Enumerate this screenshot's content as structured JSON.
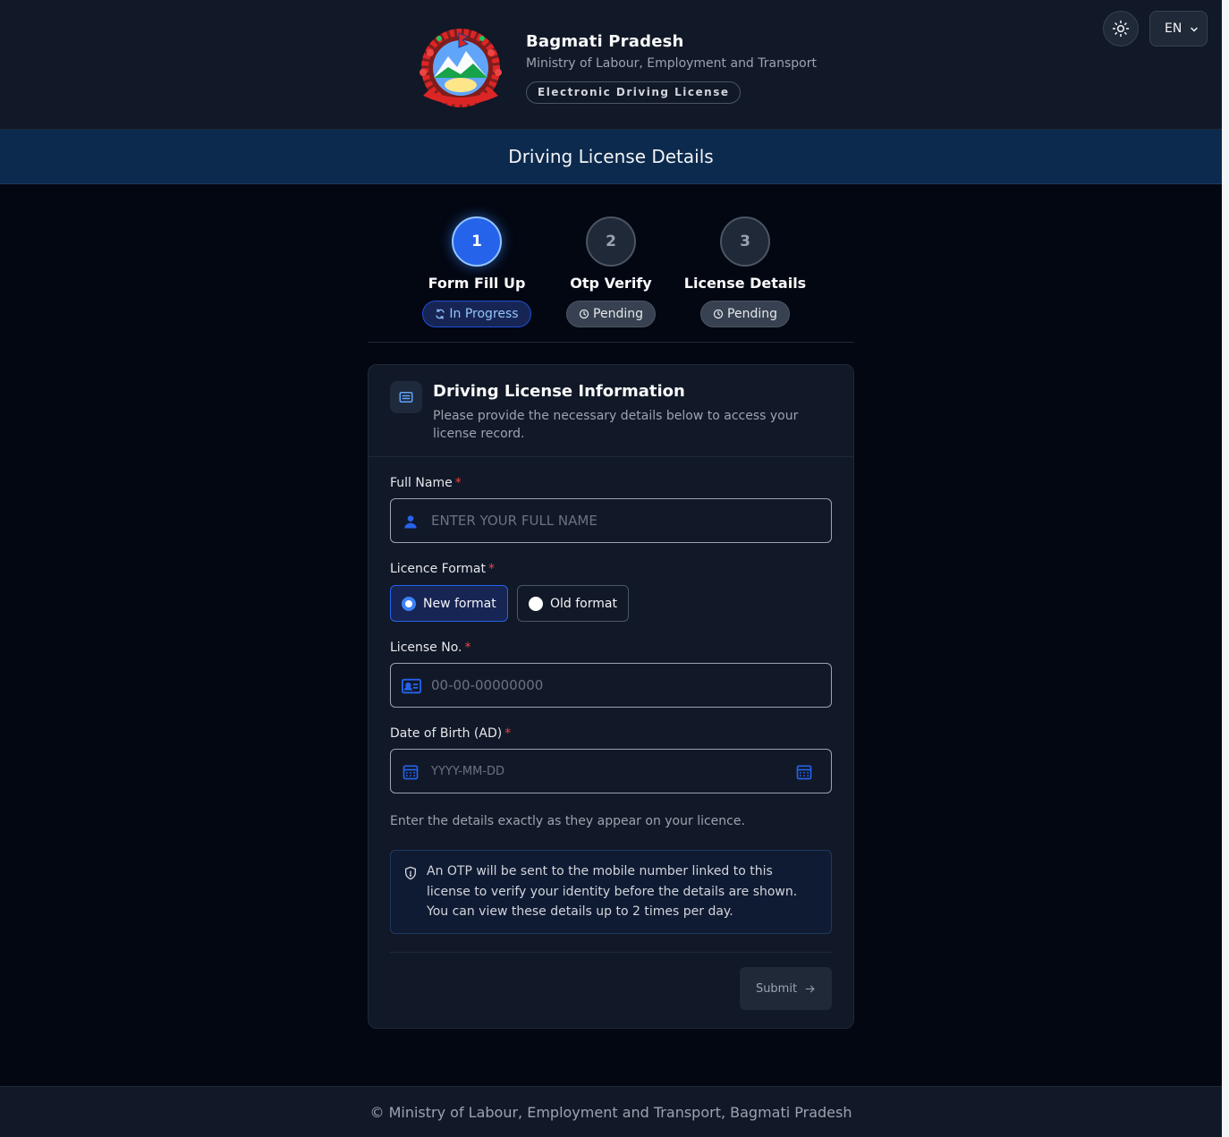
{
  "header": {
    "title": "Bagmati Pradesh",
    "subtitle": "Ministry of Labour, Employment and Transport",
    "badge": "Electronic Driving License",
    "language": "EN",
    "theme_icon": "sun-icon",
    "emblem_icon": "nepal-emblem-icon"
  },
  "banner": {
    "title": "Driving License Details"
  },
  "steps": [
    {
      "number": "1",
      "label": "Form Fill Up",
      "status": "In Progress",
      "status_icon": "refresh-icon"
    },
    {
      "number": "2",
      "label": "Otp Verify",
      "status": "Pending",
      "status_icon": "clock-icon"
    },
    {
      "number": "3",
      "label": "License Details",
      "status": "Pending",
      "status_icon": "clock-icon"
    }
  ],
  "card": {
    "title": "Driving License Information",
    "description": "Please provide the necessary details below to access your license record.",
    "icon": "document-icon"
  },
  "form": {
    "full_name": {
      "label": "Full Name",
      "required": "*",
      "placeholder": "ENTER YOUR FULL NAME",
      "icon": "user-icon"
    },
    "licence_format": {
      "label": "Licence Format",
      "required": "*",
      "options": [
        {
          "label": "New format",
          "selected": true
        },
        {
          "label": "Old format",
          "selected": false
        }
      ]
    },
    "license_no": {
      "label": "License No.",
      "required": "*",
      "placeholder": "00-00-00000000",
      "icon": "id-card-icon"
    },
    "dob": {
      "label": "Date of Birth (AD)",
      "required": "*",
      "placeholder": "YYYY-MM-DD",
      "icon": "calendar-icon"
    },
    "hint": "Enter the details exactly as they appear on your licence.",
    "notice": "An OTP will be sent to the mobile number linked to this license to verify your identity before the details are shown. You can view these details up to 2 times per day.",
    "submit_label": "Submit"
  },
  "footer": {
    "text": "© Ministry of Labour, Employment and Transport, Bagmati Pradesh"
  },
  "colors": {
    "accent": "#2563eb",
    "background": "#030712",
    "surface": "#111827",
    "required": "#ef4444"
  }
}
